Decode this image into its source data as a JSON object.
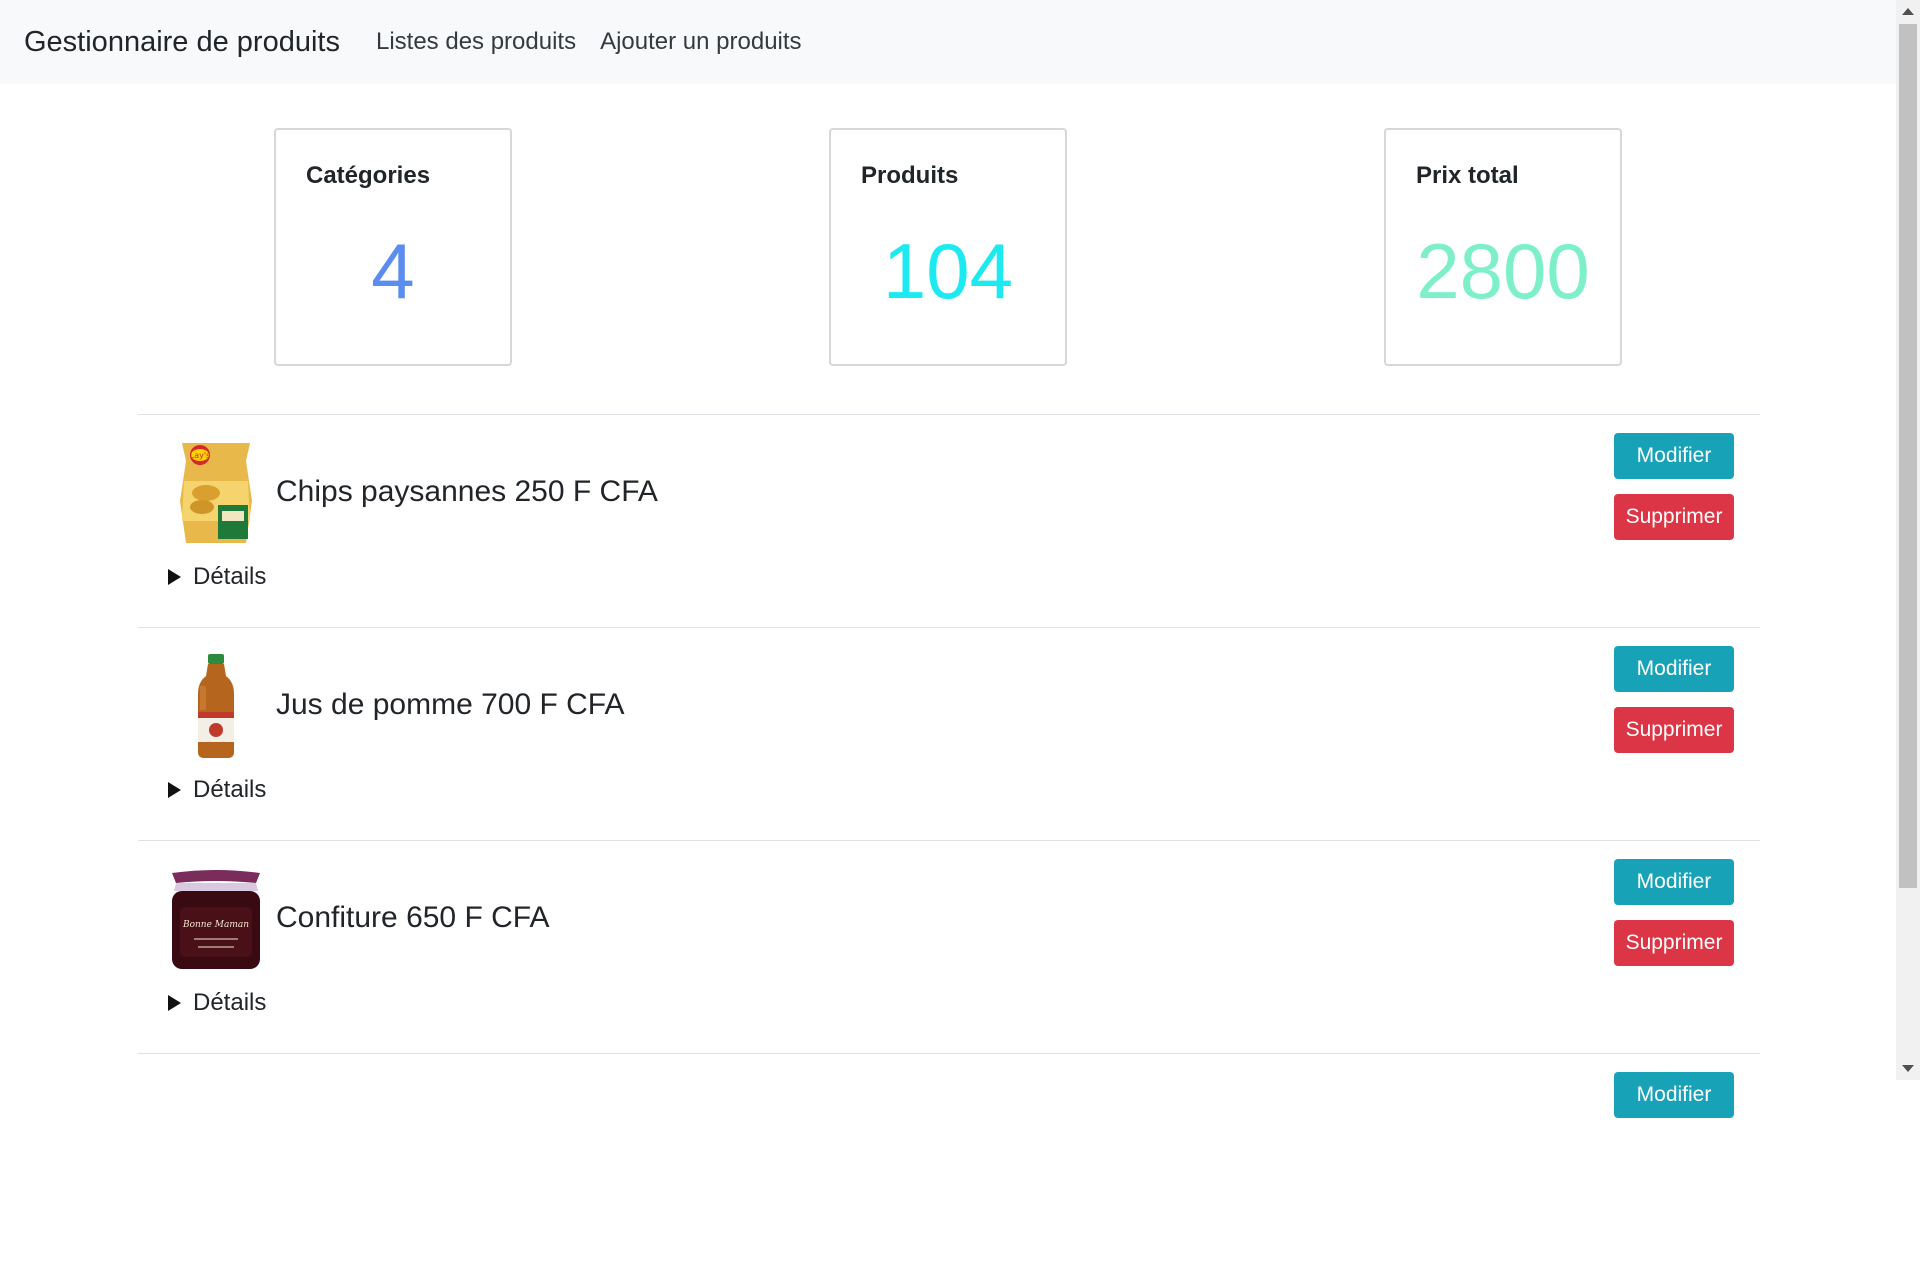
{
  "navbar": {
    "brand": "Gestionnaire de produits",
    "links": [
      "Listes des produits",
      "Ajouter un produits"
    ]
  },
  "stats": [
    {
      "label": "Catégories",
      "value": "4",
      "color": "#5b8def"
    },
    {
      "label": "Produits",
      "value": "104",
      "color": "#1de9f0"
    },
    {
      "label": "Prix total",
      "value": "2800",
      "color": "#7ef0c9"
    }
  ],
  "products": [
    {
      "name": "Chips paysannes 250 F CFA",
      "details_label": "Détails",
      "edit_label": "Modifier",
      "delete_label": "Supprimer",
      "image_icon": "chips-bag-image",
      "image_brand": "Lay's"
    },
    {
      "name": "Jus de pomme 700 F CFA",
      "details_label": "Détails",
      "edit_label": "Modifier",
      "delete_label": "Supprimer",
      "image_icon": "juice-bottle-image"
    },
    {
      "name": "Confiture 650 F CFA",
      "details_label": "Détails",
      "edit_label": "Modifier",
      "delete_label": "Supprimer",
      "image_icon": "jam-jar-image",
      "image_brand": "Bonne Maman"
    }
  ],
  "next_item": {
    "edit_label": "Modifier"
  },
  "colors": {
    "edit": "#17a2b8",
    "delete": "#dc3545",
    "navbar_bg": "#f8f9fa"
  }
}
